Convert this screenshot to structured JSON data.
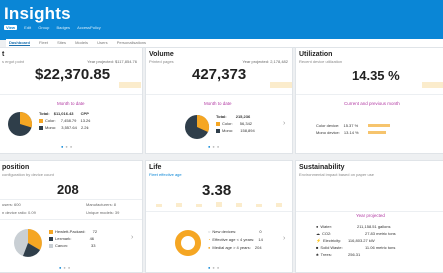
{
  "header": {
    "title": "Insights",
    "nav": [
      "View",
      "Edit",
      "Group",
      "Badges",
      "AccessPolicy"
    ],
    "subtabs": [
      "Dashboard",
      "Fleet",
      "Sites",
      "Models",
      "Users",
      "Personalisations"
    ]
  },
  "colors": {
    "brand": "#0a86d6",
    "accent_link": "#b23aa3",
    "bar": "#f6c46d",
    "pie_dark": "#2f3e4a",
    "pie_orange": "#f5a623",
    "pie_light": "#c9cfd4"
  },
  "cost": {
    "title": "t",
    "subtitle": "s ergot point",
    "year_projected": "Year projected: $117,854.76",
    "value": "$22,370.85",
    "link": "Month to date",
    "total_label": "Total:",
    "total_value": "$11,016.43",
    "cpp_label": "CPP",
    "rows": [
      {
        "label": "Color:",
        "value": "7,458.79",
        "cpp": "13.2¢"
      },
      {
        "label": "Mono:",
        "value": "3,557.64",
        "cpp": "2.2¢"
      }
    ]
  },
  "volume": {
    "title": "Volume",
    "subtitle": "Printed pages",
    "year_projected": "Year projected: 2,178,482",
    "value": "427,373",
    "link": "Month to date",
    "total_label": "Total:",
    "total_value": "215,236",
    "rows": [
      {
        "label": "Color:",
        "value": "56,342"
      },
      {
        "label": "Mono:",
        "value": "158,894"
      }
    ]
  },
  "utilization": {
    "title": "Utilization",
    "subtitle": "Recent device utilization",
    "value": "14.35 %",
    "link": "Current and previous month",
    "rows": [
      {
        "label": "Color device:",
        "value": "15.37 %",
        "fraction": 0.15
      },
      {
        "label": "Mono device:",
        "value": "13.14 %",
        "fraction": 0.13
      }
    ]
  },
  "composition": {
    "title": "position",
    "subtitle": "configuration by device count",
    "value": "208",
    "left_top": "users: 600",
    "left_bottom": "n device ratio: 0.09",
    "right_top": "Manufacturers: 8",
    "right_bottom": "Unique models: 39",
    "rows": [
      {
        "label": "Hewlett-Packard:",
        "value": "72"
      },
      {
        "label": "Lexmark:",
        "value": "46"
      },
      {
        "label": "Canon:",
        "value": "33"
      }
    ]
  },
  "life": {
    "title": "Life",
    "subtitle": "Fleet effective age",
    "value": "3.38",
    "rows": [
      {
        "label": "New devices:",
        "value": "0"
      },
      {
        "label": "Effective age < 4 years:",
        "value": "14"
      },
      {
        "label": "Medial age > 4 years:",
        "value": "204"
      }
    ]
  },
  "sustainability": {
    "title": "Sustainability",
    "subtitle": "Environmental impact based on paper use",
    "link": "Year projected",
    "rows": [
      {
        "label": "Water:",
        "value": "211,158.51 gallons"
      },
      {
        "label": "CO2:",
        "value": "27.83 metric tons"
      },
      {
        "label": "Electricity:",
        "value": "116,803.27 kW"
      },
      {
        "label": "Solid Waste:",
        "value": "11.06 metric tons"
      },
      {
        "label": "Trees:",
        "value": "256.31"
      }
    ]
  }
}
